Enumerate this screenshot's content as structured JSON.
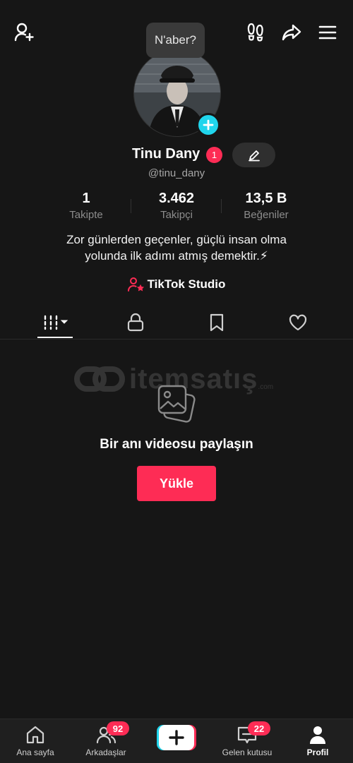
{
  "top_bar": {
    "add_friend_icon": "person-plus-icon",
    "footprint_icon": "footprints-icon",
    "share_icon": "share-arrow-icon",
    "menu_icon": "hamburger-menu-icon"
  },
  "profile": {
    "note_bubble": "N'aber?",
    "display_name": "Tinu Dany",
    "name_badge": "1",
    "username": "@tinu_dany",
    "stats": [
      {
        "value": "1",
        "label": "Takipte"
      },
      {
        "value": "3.462",
        "label": "Takipçi"
      },
      {
        "value": "13,5 B",
        "label": "Beğeniler"
      }
    ],
    "bio_line1": "Zor günlerden geçenler, güçlü insan olma",
    "bio_line2": "yolunda ilk adımı atmış demektir.⚡",
    "studio_label": "TikTok Studio"
  },
  "tabs": [
    {
      "icon": "grid-icon",
      "active": true
    },
    {
      "icon": "lock-icon",
      "active": false
    },
    {
      "icon": "bookmark-icon",
      "active": false
    },
    {
      "icon": "heart-icon",
      "active": false
    }
  ],
  "watermark": {
    "brand": "itemsatış",
    "suffix": ".com"
  },
  "empty_state": {
    "title": "Bir anı videosu paylaşın",
    "upload_label": "Yükle"
  },
  "bottom_nav": {
    "home": "Ana sayfa",
    "friends": "Arkadaşlar",
    "friends_badge": "92",
    "inbox": "Gelen kutusu",
    "inbox_badge": "22",
    "profile": "Profil"
  },
  "colors": {
    "background": "#161616",
    "accent": "#fe2c55",
    "cyan": "#20d5ec"
  }
}
